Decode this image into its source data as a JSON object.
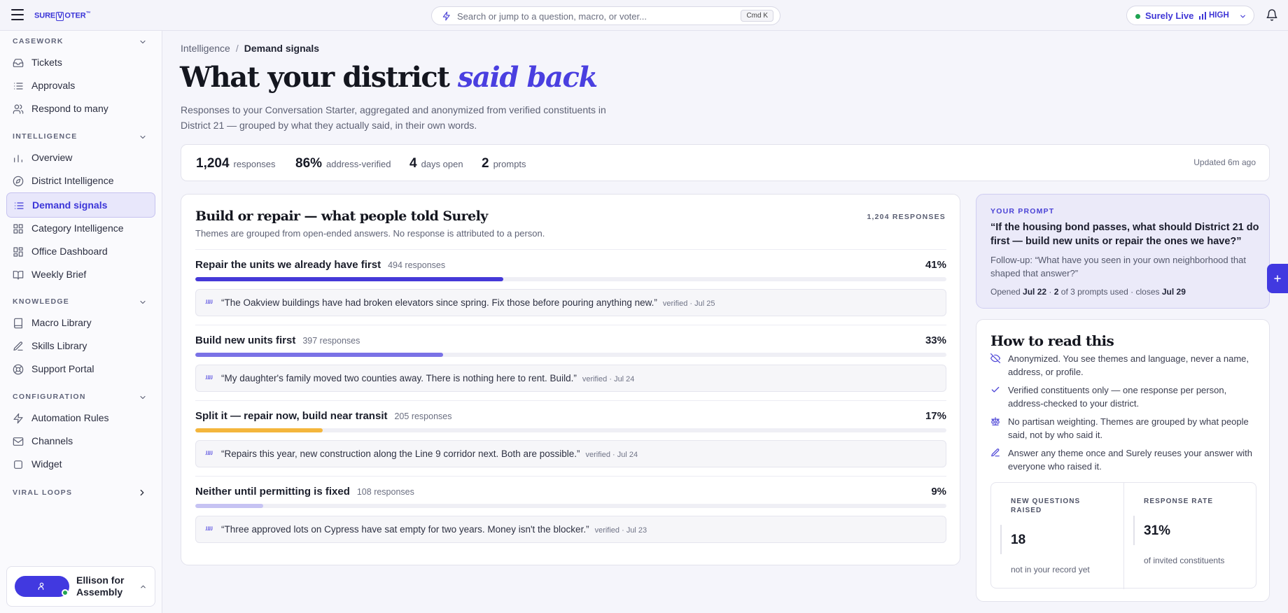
{
  "topbar": {
    "logo": {
      "pre": "SURE",
      "v": "V",
      "post": "OTER",
      "tm": "™"
    },
    "search_placeholder": "Search or jump to a question, macro, or voter...",
    "shortcut": "Cmd K",
    "live_label": "Surely Live",
    "level": "HIGH"
  },
  "sidebar": {
    "sections": [
      {
        "title": "CASEWORK",
        "items": [
          {
            "label": "Tickets",
            "icon": "ticket-icon"
          },
          {
            "label": "Approvals",
            "icon": "list-icon"
          },
          {
            "label": "Respond to many",
            "icon": "users-icon"
          }
        ]
      },
      {
        "title": "INTELLIGENCE",
        "items": [
          {
            "label": "Overview",
            "icon": "bar-chart-icon"
          },
          {
            "label": "District Intelligence",
            "icon": "compass-icon"
          },
          {
            "label": "Demand signals",
            "icon": "list-icon"
          },
          {
            "label": "Category Intelligence",
            "icon": "grid-icon"
          },
          {
            "label": "Office Dashboard",
            "icon": "layout-icon"
          },
          {
            "label": "Weekly Brief",
            "icon": "book-icon"
          }
        ]
      },
      {
        "title": "KNOWLEDGE",
        "items": [
          {
            "label": "Macro Library",
            "icon": "book-icon"
          },
          {
            "label": "Skills Library",
            "icon": "pen-icon"
          },
          {
            "label": "Support Portal",
            "icon": "lifebuoy-icon"
          }
        ]
      },
      {
        "title": "CONFIGURATION",
        "items": [
          {
            "label": "Automation Rules",
            "icon": "bolt-icon"
          },
          {
            "label": "Channels",
            "icon": "mail-icon"
          },
          {
            "label": "Widget",
            "icon": "square-icon"
          }
        ]
      },
      {
        "title": "VIRAL LOOPS",
        "items": []
      }
    ],
    "active_item": "Demand signals",
    "account": {
      "name_line1": "Ellison for",
      "name_line2": "Assembly"
    }
  },
  "breadcrumb": {
    "parent": "Intelligence",
    "sep": "/",
    "current": "Demand signals"
  },
  "page": {
    "title_plain": "What your district ",
    "title_em": "said back",
    "subtitle": "Responses to your Conversation Starter, aggregated and anonymized from verified constituents in District 21 — grouped by what they actually said, in their own words."
  },
  "stats": {
    "items": [
      {
        "value": "1,204",
        "label": "responses"
      },
      {
        "value": "86%",
        "label": "address-verified"
      },
      {
        "value": "4",
        "label": "days open"
      },
      {
        "value": "2",
        "label": "prompts"
      }
    ],
    "updated": "Updated 6m ago"
  },
  "themes_card": {
    "title": "Build or repair — what people told Surely",
    "note": "Themes are grouped from open-ended answers. No response is attributed to a person.",
    "total": "1,204 RESPONSES",
    "themes": [
      {
        "title": "Repair the units we already have first",
        "count": "494 responses",
        "pct": "41%",
        "share": 0.41,
        "color": "#4539d8",
        "quote": "“The Oakview buildings have had broken elevators since spring. Fix those before pouring anything new.”",
        "verified": "verified · Jul 25"
      },
      {
        "title": "Build new units first",
        "count": "397 responses",
        "pct": "33%",
        "share": 0.33,
        "color": "#7a72e6",
        "quote": "“My daughter's family moved two counties away. There is nothing here to rent. Build.”",
        "verified": "verified · Jul 24"
      },
      {
        "title": "Split it — repair now, build near transit",
        "count": "205 responses",
        "pct": "17%",
        "share": 0.17,
        "color": "#f4b63c",
        "quote": "“Repairs this year, new construction along the Line 9 corridor next. Both are possible.”",
        "verified": "verified · Jul 24"
      },
      {
        "title": "Neither until permitting is fixed",
        "count": "108 responses",
        "pct": "9%",
        "share": 0.09,
        "color": "#c6c3f3",
        "quote": "“Three approved lots on Cypress have sat empty for two years. Money isn't the blocker.”",
        "verified": "verified · Jul 23"
      }
    ]
  },
  "prompt": {
    "label": "YOUR PROMPT",
    "question": "“If the housing bond passes, what should District 21 do first — build new units or repair the ones we have?”",
    "followup": "Follow-up: “What have you seen in your own neighborhood that shaped that answer?”",
    "meta": {
      "opened_text": "Opened ",
      "opened": "Jul 22",
      "dot1": " · ",
      "used_num": "2",
      "used_text": " of 3 prompts used · closes ",
      "closes": "Jul 29"
    }
  },
  "howto": {
    "title": "How to read this",
    "rows": [
      {
        "icon": "eye-off-icon",
        "text": "Anonymized. You see themes and language, never a name, address, or profile."
      },
      {
        "icon": "check-icon",
        "text": "Verified constituents only — one response per person, address-checked to your district."
      },
      {
        "icon": "scale-icon",
        "text": "No partisan weighting. Themes are grouped by what people said, not by who said it."
      },
      {
        "icon": "pen-icon",
        "text": "Answer any theme once and Surely reuses your answer with everyone who raised it."
      }
    ],
    "metrics": [
      {
        "label": "NEW QUESTIONS RAISED",
        "value": "18",
        "sub": "not in your record yet"
      },
      {
        "label": "RESPONSE RATE",
        "value": "31%",
        "sub": "of invited constituents"
      }
    ]
  },
  "colors": {
    "accent": "#4139e0",
    "live_dot": "#1ea351",
    "active_bg": "#e8e7fb"
  }
}
